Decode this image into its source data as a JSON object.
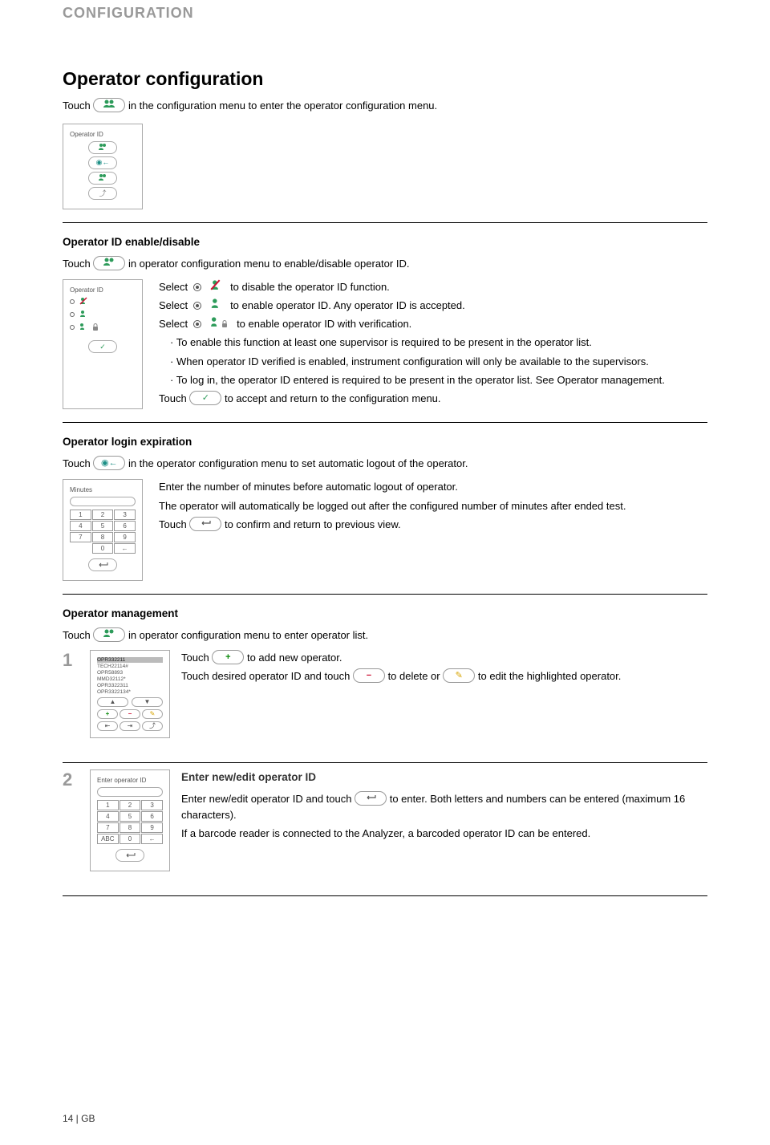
{
  "chapter": "CONFIGURATION",
  "title": "Operator configuration",
  "intro_pre": "Touch",
  "intro_post": "in the configuration menu to enter the operator configuration menu.",
  "thumb1_title": "Operator ID",
  "sec_enable": {
    "heading": "Operator ID enable/disable",
    "lead_pre": "Touch",
    "lead_post": "in operator configuration menu to enable/disable operator ID.",
    "thumb_title": "Operator ID",
    "opt1_a": "Select",
    "opt1_b": "to disable the operator ID function.",
    "opt2_a": "Select",
    "opt2_b": "to enable operator ID. Any operator ID is accepted.",
    "opt3_a": "Select",
    "opt3_b": "to enable operator ID with verification.",
    "note1": "· To enable this function at least one supervisor is required to be present in the operator list.",
    "note2": "· When operator ID verified is enabled, instrument configuration will only be available to the supervisors.",
    "note3": "· To log in, the operator ID entered is required to be present in the operator list. See Operator management.",
    "touch_a": "Touch",
    "touch_b": "to accept and return to the configuration menu."
  },
  "sec_login": {
    "heading": "Operator login expiration",
    "lead_pre": "Touch",
    "lead_post": "in the operator configuration menu to set automatic logout of the operator.",
    "thumb_title": "Minutes",
    "line1": "Enter the number of minutes before automatic logout of operator.",
    "line2": "The operator will automatically be logged out after the configured number of minutes after ended test.",
    "touch_a": "Touch",
    "touch_b": "to confirm and return to previous view."
  },
  "sec_mgmt": {
    "heading": "Operator management",
    "lead_pre": "Touch",
    "lead_post": "in operator configuration menu to enter operator list.",
    "step1_num": "1",
    "step1_list": [
      "OPR332211",
      "TECH22114#",
      "OPR58893",
      "MMD32112*",
      "OPR3322311",
      "OPR3322134*"
    ],
    "step1_a": "Touch",
    "step1_b": "to add new operator.",
    "step1_c": "Touch desired operator ID and touch",
    "step1_d": "to delete or",
    "step1_e": "to edit the highlighted operator.",
    "step2_num": "2",
    "step2_heading": "Enter new/edit operator ID",
    "step2_thumb_title": "Enter operator ID",
    "step2_a": "Enter new/edit operator ID and touch",
    "step2_b": "to enter. Both letters and numbers can be entered (maximum 16 characters).",
    "step2_c": "If a barcode reader is connected to the Analyzer, a barcoded operator ID can be entered."
  },
  "footer": "14  |  GB"
}
